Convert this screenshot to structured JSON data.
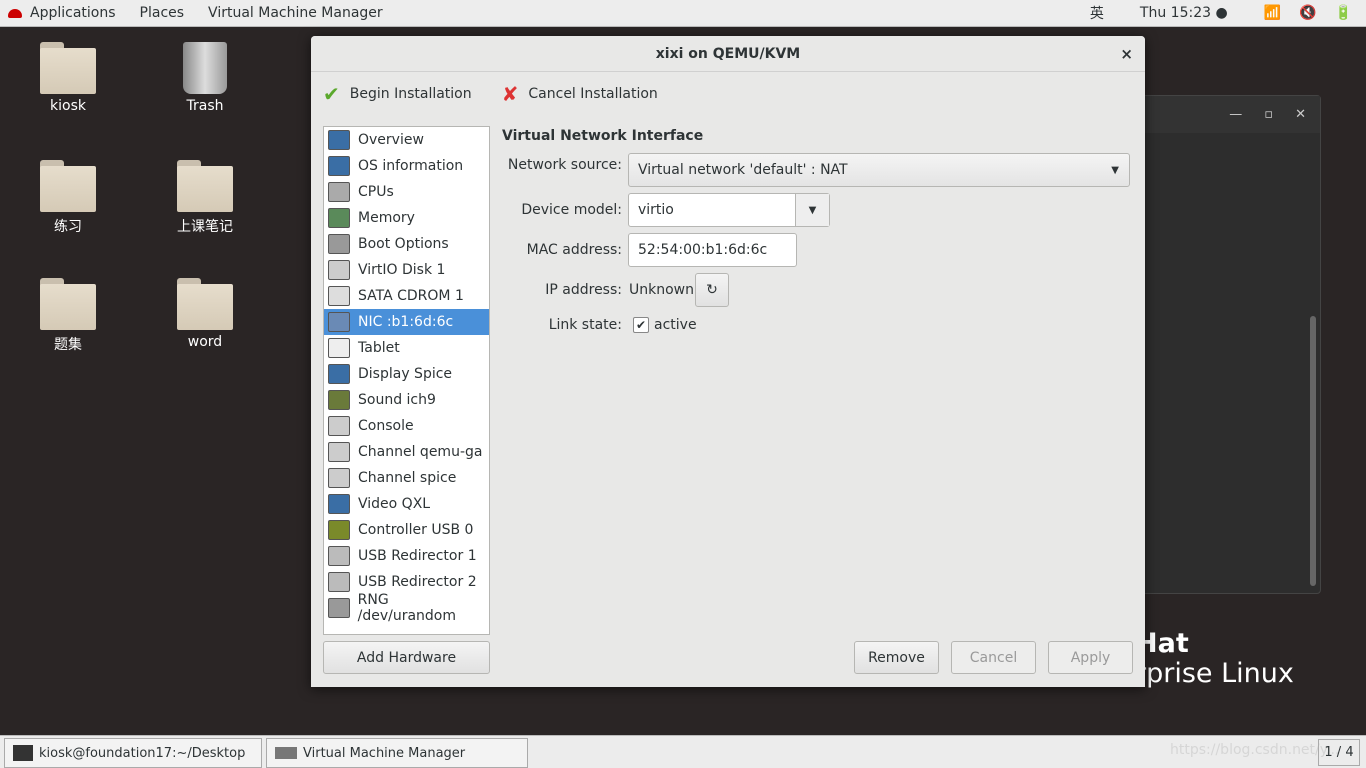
{
  "topbar": {
    "applications": "Applications",
    "places": "Places",
    "app": "Virtual Machine Manager",
    "input_method": "英",
    "clock": "Thu 15:23 ●",
    "icons": [
      "wifi-icon",
      "volume-muted-icon",
      "battery-icon"
    ]
  },
  "desktop": {
    "icons": [
      {
        "label": "kiosk",
        "type": "home-folder"
      },
      {
        "label": "Trash",
        "type": "trash"
      },
      {
        "label": "练习",
        "type": "folder"
      },
      {
        "label": "上课笔记",
        "type": "folder"
      },
      {
        "label": "题集",
        "type": "folder"
      },
      {
        "label": "word",
        "type": "folder"
      }
    ],
    "brand_line1": "Hat",
    "brand_line2": "rprise Linux"
  },
  "dialog": {
    "title": "xixi on QEMU/KVM",
    "close": "×",
    "begin": "Begin Installation",
    "cancel_install": "Cancel Installation",
    "hardware": [
      "Overview",
      "OS information",
      "CPUs",
      "Memory",
      "Boot Options",
      "VirtIO Disk 1",
      "SATA CDROM 1",
      "NIC :b1:6d:6c",
      "Tablet",
      "Display Spice",
      "Sound ich9",
      "Console",
      "Channel qemu-ga",
      "Channel spice",
      "Video QXL",
      "Controller USB 0",
      "USB Redirector 1",
      "USB Redirector 2",
      "RNG /dev/urandom"
    ],
    "selected_index": 7,
    "add_hardware": "Add Hardware",
    "section_title": "Virtual Network Interface",
    "network_source_label": "Network source:",
    "network_source": "Virtual network 'default' : NAT",
    "device_model_label": "Device model:",
    "device_model": "virtio",
    "mac_label": "MAC address:",
    "mac": "52:54:00:b1:6d:6c",
    "ip_label": "IP address:",
    "ip": "Unknown",
    "link_label": "Link state:",
    "link_active": "active",
    "link_checked": true,
    "remove": "Remove",
    "cancel": "Cancel",
    "apply": "Apply"
  },
  "taskbar": {
    "terminal": "kiosk@foundation17:~/Desktop",
    "vmm": "Virtual Machine Manager",
    "workspace": "1 / 4",
    "watermark": "https://blog.csdn.net/y..."
  }
}
